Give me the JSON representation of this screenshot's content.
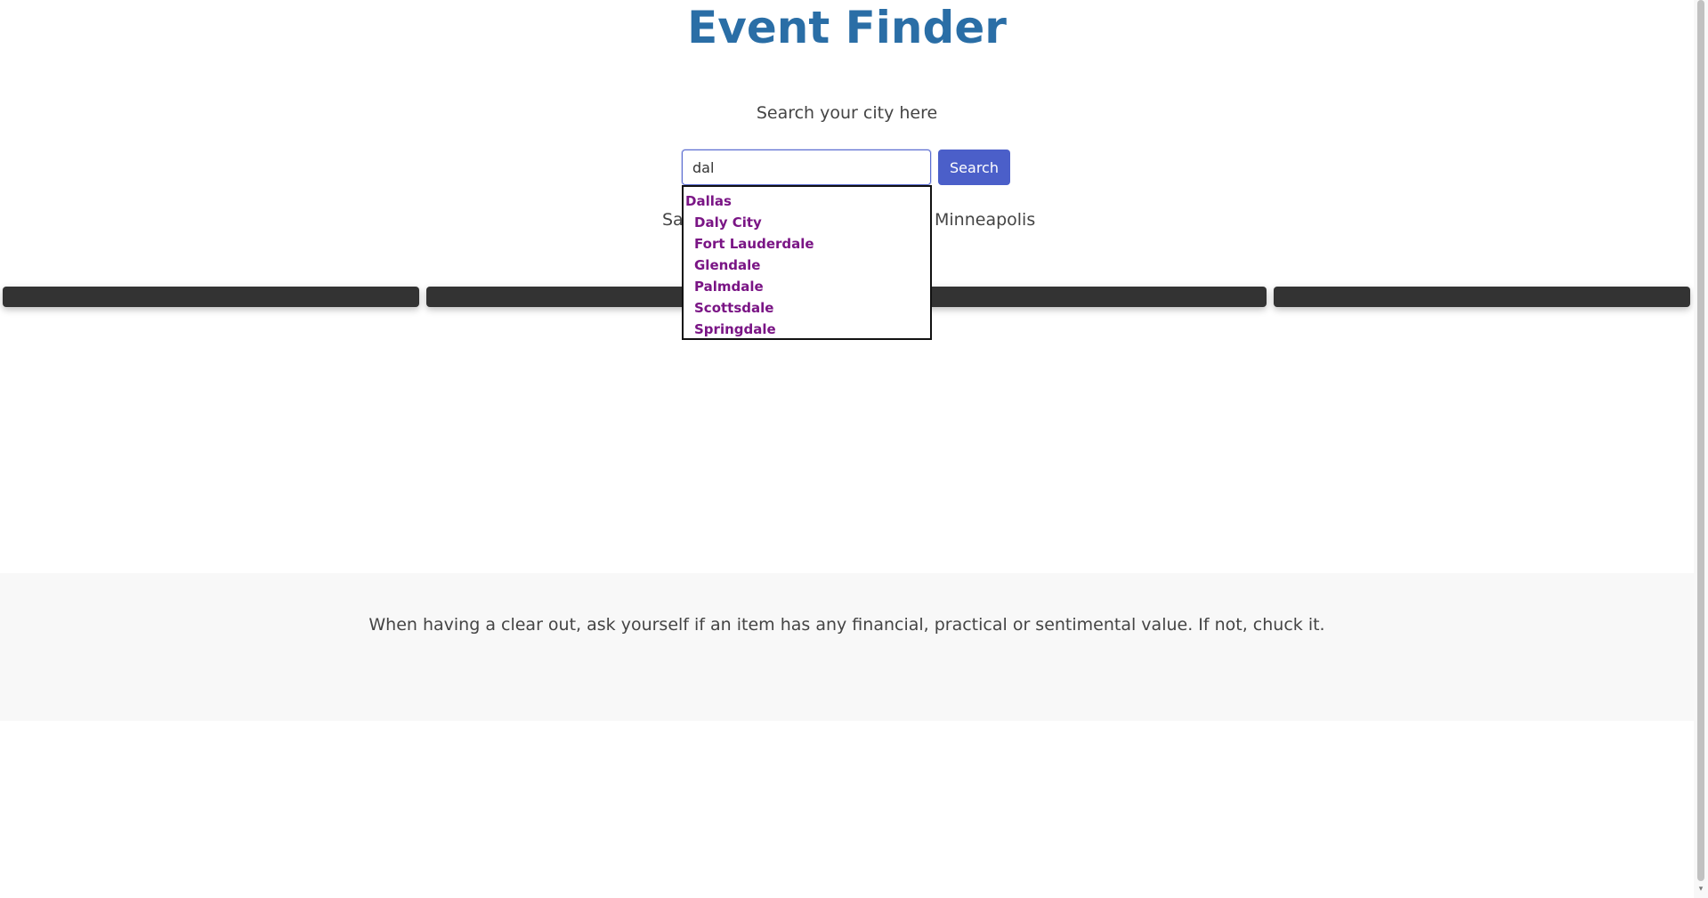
{
  "app": {
    "title": "Event Finder"
  },
  "search": {
    "prompt": "Search your city here",
    "value": "dal",
    "button_label": "Search"
  },
  "quick_cities": {
    "items": [
      {
        "label": "Sa"
      },
      {
        "label": "Minneapolis"
      }
    ]
  },
  "autocomplete": {
    "items": [
      {
        "label": "Dallas"
      },
      {
        "label": "Daly City"
      },
      {
        "label": "Fort Lauderdale"
      },
      {
        "label": "Glendale"
      },
      {
        "label": "Palmdale"
      },
      {
        "label": "Scottsdale"
      },
      {
        "label": "Springdale"
      }
    ]
  },
  "footer": {
    "tip": "When having a clear out, ask yourself if an item has any financial, practical or sentimental value. If not, chuck it."
  },
  "scrollbar": {
    "down_arrow": "▾"
  },
  "colors": {
    "title": "#2a6ea6",
    "button": "#4b5fc9",
    "suggestion": "#7a1585",
    "card": "#333333",
    "footer_band": "#f8f8f8"
  }
}
